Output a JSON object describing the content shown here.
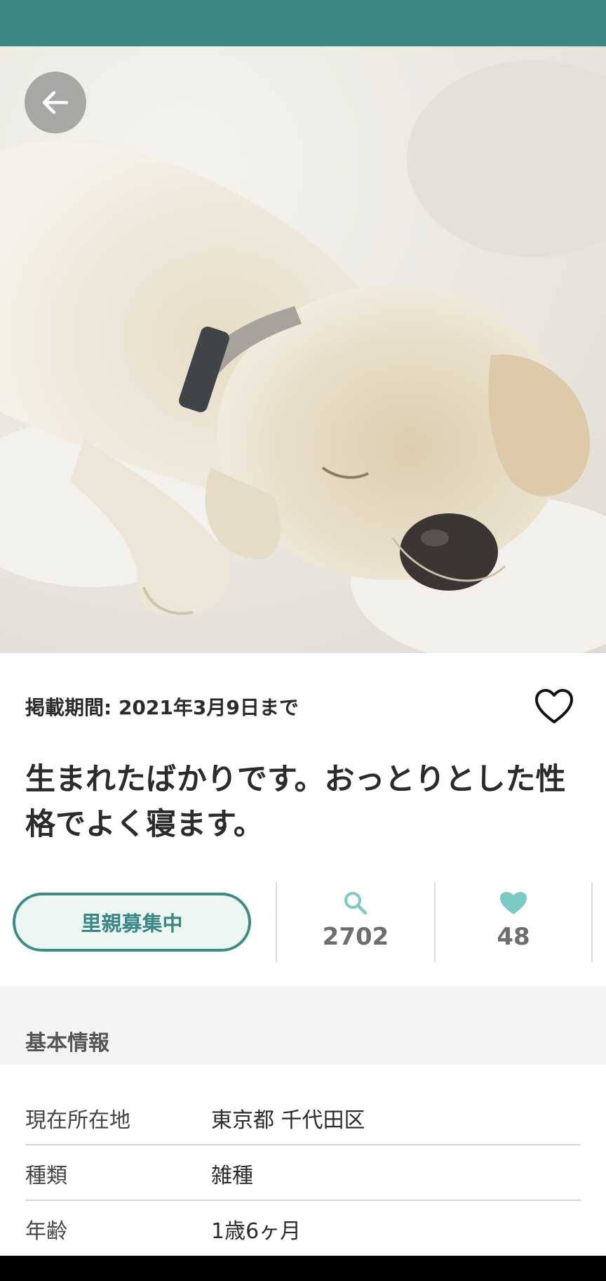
{
  "app": {
    "accent_color": "#3a8784",
    "status_bar_color": "#3a8784"
  },
  "hero": {
    "image_alt": "sleeping puppy on white blanket"
  },
  "listing": {
    "period": "掲載期間: 2021年3月9日まで",
    "title": "生まれたばかりです。おっとりとした性格でよく寝ます。",
    "status_label": "里親募集中",
    "views": "2702",
    "likes": "48"
  },
  "basic_info": {
    "heading": "基本情報",
    "rows": [
      {
        "key": "現在所在地",
        "value": "東京都 千代田区"
      },
      {
        "key": "種類",
        "value": "雑種"
      },
      {
        "key": "年齢",
        "value": "1歳6ヶ月"
      }
    ]
  },
  "icons": {
    "back": "arrow-left-icon",
    "favorite": "heart-outline-icon",
    "views": "search-icon",
    "likes": "heart-filled-icon"
  }
}
